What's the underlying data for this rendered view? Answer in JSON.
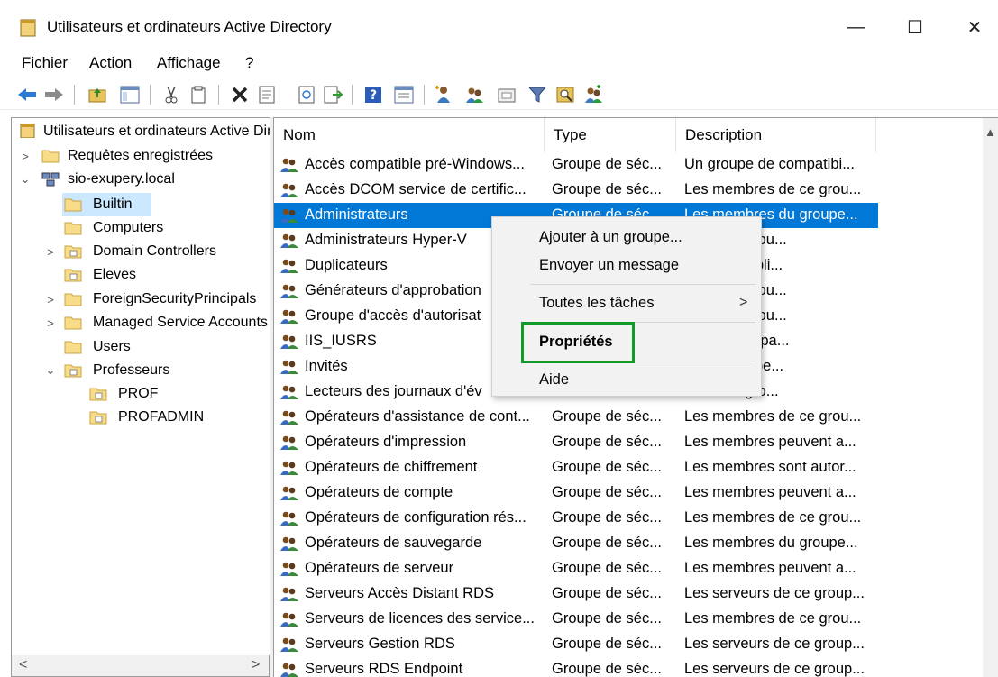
{
  "window": {
    "title": "Utilisateurs et ordinateurs Active Directory",
    "minimize": "—",
    "maximize": "☐",
    "close": "✕"
  },
  "menu": [
    "Fichier",
    "Action",
    "Affichage",
    "?"
  ],
  "toolbar_icons": [
    "back-icon",
    "forward-icon",
    "up-folder-icon",
    "show-hide-tree-icon",
    "cut-icon",
    "copy-icon",
    "delete-icon",
    "properties-icon",
    "refresh-icon",
    "export-icon",
    "help-icon",
    "view-icon",
    "new-user-icon",
    "new-group-icon",
    "new-ou-icon",
    "filter-icon",
    "find-icon",
    "add-to-group-icon"
  ],
  "tree": {
    "root": "Utilisateurs et ordinateurs Active Directory",
    "items": [
      {
        "label": "Requêtes enregistrées",
        "twisty": ">"
      },
      {
        "label": "sio-exupery.local",
        "twisty": "⌄"
      },
      {
        "label": "Builtin",
        "twisty": ""
      },
      {
        "label": "Computers",
        "twisty": ""
      },
      {
        "label": "Domain Controllers",
        "twisty": ">"
      },
      {
        "label": "Eleves",
        "twisty": ""
      },
      {
        "label": "ForeignSecurityPrincipals",
        "twisty": ">"
      },
      {
        "label": "Managed Service Accounts",
        "twisty": ">"
      },
      {
        "label": "Users",
        "twisty": ""
      },
      {
        "label": "Professeurs",
        "twisty": "⌄"
      },
      {
        "label": "PROF",
        "twisty": ""
      },
      {
        "label": "PROFADMIN",
        "twisty": ""
      }
    ],
    "scroll_left": "<",
    "scroll_right": ">"
  },
  "columns": [
    "Nom",
    "Type",
    "Description"
  ],
  "rows": [
    {
      "name": "Accès compatible pré-Windows...",
      "type": "Groupe de séc...",
      "desc": "Un groupe de compatibi..."
    },
    {
      "name": "Accès DCOM service de certific...",
      "type": "Groupe de séc...",
      "desc": "Les membres de ce grou..."
    },
    {
      "name": "Administrateurs",
      "type": "Groupe de séc...",
      "desc": "Les membres du groupe..."
    },
    {
      "name": "Administrateurs Hyper-V",
      "type": "",
      "desc": "es de ce grou..."
    },
    {
      "name": "Duplicateurs",
      "type": "",
      "desc": "harge la répli..."
    },
    {
      "name": "Générateurs d'approbation",
      "type": "",
      "desc": "es de ce grou..."
    },
    {
      "name": "Groupe d'accès d'autorisat",
      "type": "",
      "desc": "es de ce grou..."
    },
    {
      "name": "IIS_IUSRS",
      "type": "",
      "desc": "égré utilisé pa..."
    },
    {
      "name": "Invités",
      "type": "",
      "desc": "es du groupe..."
    },
    {
      "name": "Lecteurs des journaux d'év",
      "type": "",
      "desc": "es de ce gro..."
    },
    {
      "name": "Opérateurs d'assistance de cont...",
      "type": "Groupe de séc...",
      "desc": "Les membres de ce grou..."
    },
    {
      "name": "Opérateurs d'impression",
      "type": "Groupe de séc...",
      "desc": "Les membres peuvent a..."
    },
    {
      "name": "Opérateurs de chiffrement",
      "type": "Groupe de séc...",
      "desc": "Les membres sont autor..."
    },
    {
      "name": "Opérateurs de compte",
      "type": "Groupe de séc...",
      "desc": "Les membres peuvent a..."
    },
    {
      "name": "Opérateurs de configuration rés...",
      "type": "Groupe de séc...",
      "desc": "Les membres de ce grou..."
    },
    {
      "name": "Opérateurs de sauvegarde",
      "type": "Groupe de séc...",
      "desc": "Les membres du groupe..."
    },
    {
      "name": "Opérateurs de serveur",
      "type": "Groupe de séc...",
      "desc": "Les membres peuvent a..."
    },
    {
      "name": "Serveurs Accès Distant RDS",
      "type": "Groupe de séc...",
      "desc": "Les serveurs de ce group..."
    },
    {
      "name": "Serveurs de licences des service...",
      "type": "Groupe de séc...",
      "desc": "Les membres de ce grou..."
    },
    {
      "name": "Serveurs Gestion RDS",
      "type": "Groupe de séc...",
      "desc": "Les serveurs de ce group..."
    },
    {
      "name": "Serveurs RDS Endpoint",
      "type": "Groupe de séc...",
      "desc": "Les serveurs de ce group..."
    }
  ],
  "context_menu": {
    "add_to_group": "Ajouter à un groupe...",
    "send_message": "Envoyer un message",
    "all_tasks": "Toutes les tâches",
    "all_tasks_arrow": ">",
    "properties": "Propriétés",
    "help": "Aide"
  },
  "colors": {
    "selection": "#0078d7",
    "tree_selection": "#cce8ff",
    "highlight_box": "#109a2a"
  }
}
